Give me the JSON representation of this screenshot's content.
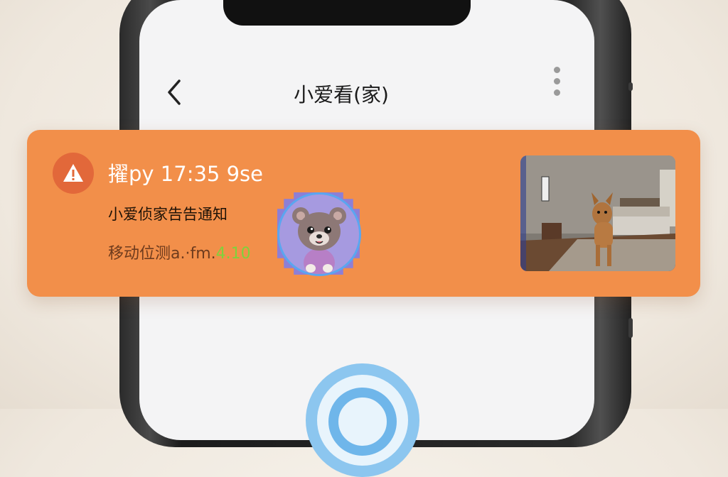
{
  "app": {
    "nav_title": "小爱看(家)",
    "back_icon": "chevron-left-icon",
    "menu_icon": "more-vertical-icon"
  },
  "notification": {
    "header": "擢py 17:35 9se",
    "title": "小爱侦家告告通知",
    "body_prefix": "移动位测a.·fm.",
    "body_highlight": "4.10",
    "icon": "warning-icon",
    "accent_color": "#f28f4a",
    "badge_color": "#e2683a",
    "avatar": "bear-avatar",
    "snapshot": "camera-snapshot-dog-in-bedroom"
  },
  "bottom": {
    "icon": "ring-button-icon"
  }
}
